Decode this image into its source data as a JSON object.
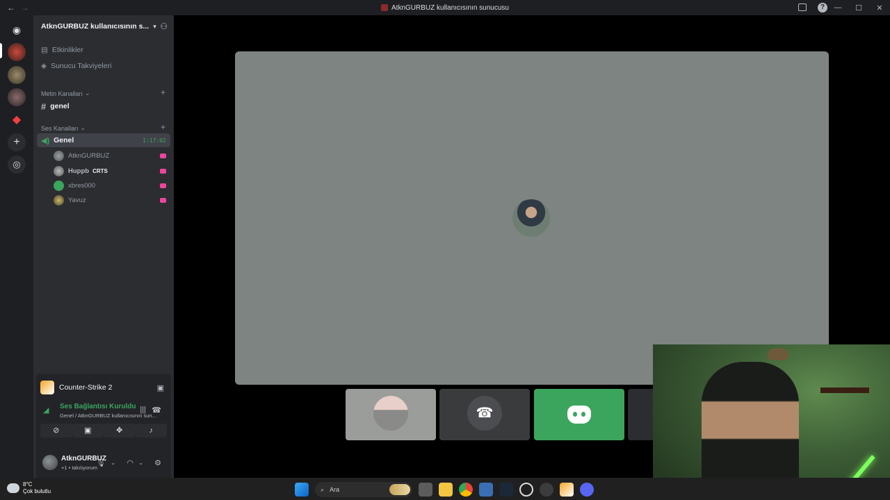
{
  "window": {
    "title": "AtknGURBUZ kullanıcısının sunucusu",
    "back": "←",
    "forward": "→",
    "help": "?",
    "controls": {
      "minimize": "—",
      "maximize": "☐",
      "close": "✕"
    }
  },
  "server": {
    "name": "AtknGURBUZ kullanıcısının s...",
    "menu": [
      {
        "label": "Etkinlikler",
        "icon": "calendar-icon"
      },
      {
        "label": "Sunucu Takviyeleri",
        "icon": "boost-icon"
      }
    ],
    "text_category": "Metin Kanalları",
    "text_channels": [
      {
        "name": "genel"
      }
    ],
    "voice_category": "Ses Kanalları",
    "voice_channel": {
      "name": "Genel",
      "timer": "1:17:02",
      "users": [
        {
          "name": "AtknGURBUZ",
          "badge": ""
        },
        {
          "name": "Huppb",
          "badge": "CRTS"
        },
        {
          "name": "xbres000",
          "badge": ""
        },
        {
          "name": "Yavuz",
          "badge": ""
        }
      ]
    }
  },
  "activity": {
    "game": "Counter-Strike 2"
  },
  "connection": {
    "status": "Ses Bağlantısı Kuruldu",
    "detail": "Genel / AtknGURBUZ kullanıcısının sun..."
  },
  "user": {
    "name": "AtknGURBUZ",
    "status": "+1 • takılıyorum"
  },
  "taskbar": {
    "temperature": "8°C",
    "weather": "Çok bulutlu",
    "search_placeholder": "Ara"
  },
  "colors": {
    "accent_green": "#3ba55d",
    "live_pink": "#eb459e",
    "stage_bg": "#7d8482"
  }
}
